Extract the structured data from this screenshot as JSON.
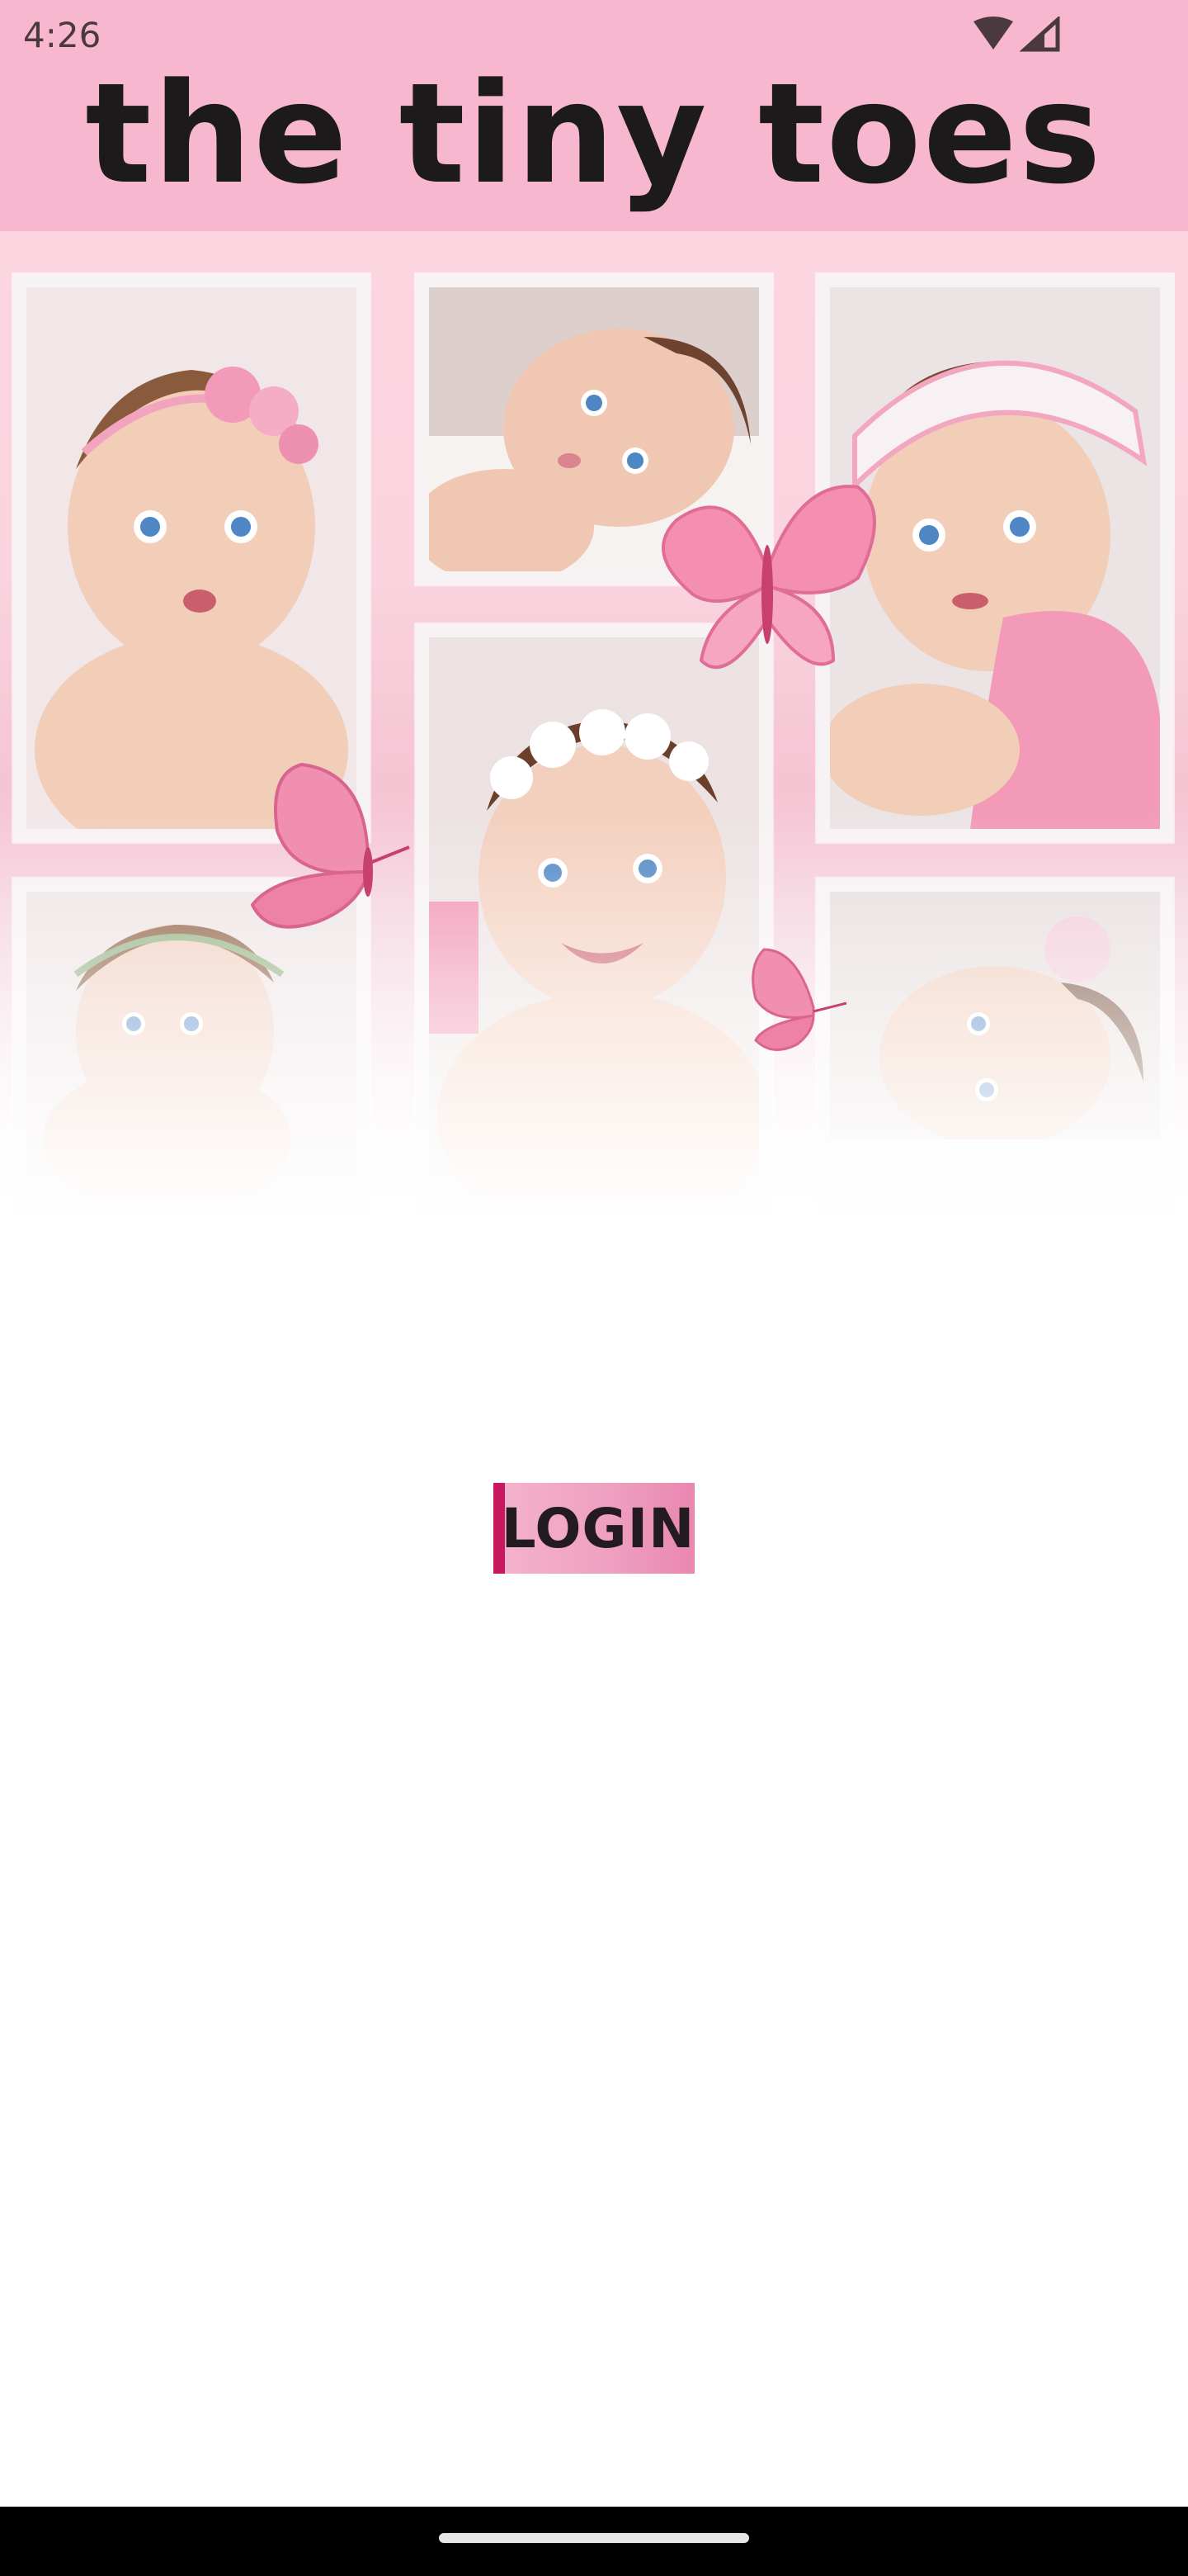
{
  "status_bar": {
    "time": "4:26",
    "icons": [
      "wifi-icon",
      "cellular-signal-icon"
    ]
  },
  "header": {
    "title": "the tiny toes",
    "background": "#f7b8cf"
  },
  "hero": {
    "photos": [
      {
        "name": "baby-photo-flower-headband"
      },
      {
        "name": "baby-photo-lying-down"
      },
      {
        "name": "baby-photo-knit-headband"
      },
      {
        "name": "baby-photo-smiling-daisy-headband"
      },
      {
        "name": "baby-photo-garland"
      },
      {
        "name": "baby-photo-lying-side"
      }
    ],
    "decorations": [
      "butterfly-icon",
      "butterfly-icon",
      "butterfly-icon"
    ]
  },
  "login": {
    "label": "LOGIN",
    "accent_color": "#c8185f"
  },
  "colors": {
    "accent": "#c8185f",
    "header_pink": "#f7b8cf",
    "button_pink": "#ee9fbf"
  }
}
